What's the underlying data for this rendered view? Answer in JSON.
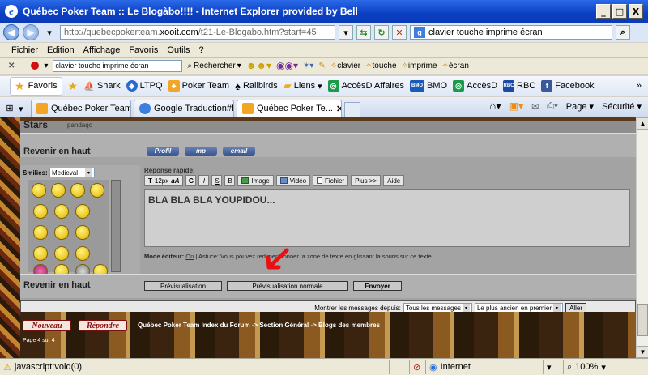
{
  "window": {
    "title": "Québec Poker Team :: Le Blogàbo!!!! - Internet Explorer provided by Bell",
    "buttons": {
      "minimize": "_",
      "maximize": "□",
      "close": "X"
    }
  },
  "address": {
    "url_prefix": "http://quebecpokerteam.",
    "url_domain": "xooit.com",
    "url_suffix": "/t21-Le-Blogabo.htm?start=45",
    "search_text": "clavier  touche imprime écran"
  },
  "menu": {
    "items": [
      "Fichier",
      "Edition",
      "Affichage",
      "Favoris",
      "Outils",
      "?"
    ]
  },
  "google_toolbar": {
    "search_text": "clavier  touche imprime écran",
    "search_button": "Rechercher",
    "links": [
      "clavier",
      "touche",
      "imprime",
      "écran"
    ]
  },
  "favorites": {
    "label": "Favoris",
    "items": [
      "Shark",
      "LTPQ",
      "Poker Team",
      "Railbirds",
      "Liens",
      "AccèsD Affaires",
      "BMO",
      "AccèsD",
      "RBC",
      "Facebook"
    ],
    "icons": [
      "BMO",
      "RBC"
    ]
  },
  "tabs": {
    "items": [
      "Québec Poker Team ...",
      "Google Traduction#f...",
      "Québec Poker Te..."
    ],
    "active_index": 2
  },
  "tools": {
    "page": "Page",
    "security": "Sécurité"
  },
  "forum": {
    "post_author_prefix": "Stars",
    "post_author": "pandaqc",
    "back_to_top": "Revenir en haut",
    "profile_buttons": [
      "Profil",
      "mp",
      "email"
    ],
    "smilies_label": "Smilies:",
    "smilies_set": "Medieval",
    "quick_reply_title": "Réponse rapide:",
    "toolbar": {
      "font": "12px",
      "font_icon": "aA",
      "bold": "G",
      "italic": "I",
      "underline": "S",
      "strike": "B",
      "image": "Image",
      "video": "Vidéo",
      "file": "Fichier",
      "more": "Plus >>",
      "help": "Aide"
    },
    "message": "BLA BLA BLA YOUPIDOU...",
    "editor_mode_label": "Mode éditeur:",
    "editor_mode_value": "On",
    "editor_tip": "| Astuce: Vous pouvez redimensionner la zone de texte en glissant la souris sur ce texte.",
    "back_to_top_2": "Revenir en haut",
    "preview_button": "Prévisualisation",
    "preview_normal_button": "Prévisualisation normale",
    "send_button": "Envoyer",
    "show_messages_label": "Montrer les messages depuis:",
    "show_messages_value": "Tous les messages",
    "order_value": "Le plus ancien en premier",
    "go_button": "Aller"
  },
  "banner": {
    "new_button": "Nouveau",
    "reply_button": "Répondre",
    "breadcrumb": "Québec Poker Team Index du Forum -> Section Général -> Blogs des membres",
    "page_info": "Page 4 sur 4"
  },
  "status": {
    "left_text": "javascript:void(0)",
    "zone": "Internet",
    "zoom": "100%"
  },
  "colors": {
    "titlebar": "#0a3fc2",
    "annotation_arrow": "#e81010",
    "banner_button_text": "#8a0f0f"
  }
}
